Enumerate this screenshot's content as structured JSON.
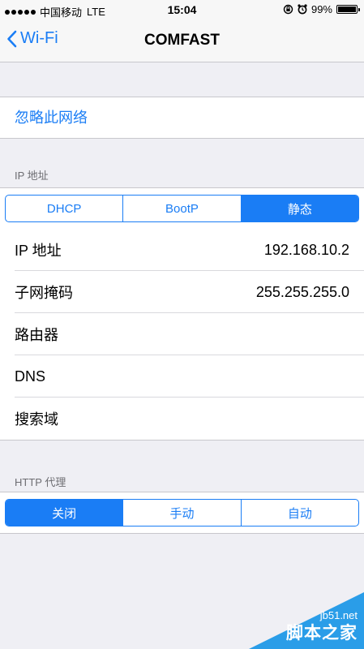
{
  "status_bar": {
    "carrier": "中国移动",
    "network": "LTE",
    "time": "15:04",
    "battery_text": "99%",
    "battery_level": 0.99
  },
  "nav": {
    "back_label": "Wi-Fi",
    "title": "COMFAST"
  },
  "forget_label": "忽略此网络",
  "ip_section": {
    "header": "IP 地址",
    "modes": [
      "DHCP",
      "BootP",
      "静态"
    ],
    "selected_mode": 2,
    "rows": [
      {
        "label": "IP 地址",
        "value": "192.168.10.2"
      },
      {
        "label": "子网掩码",
        "value": "255.255.255.0"
      },
      {
        "label": "路由器",
        "value": ""
      },
      {
        "label": "DNS",
        "value": ""
      },
      {
        "label": "搜索域",
        "value": ""
      }
    ]
  },
  "proxy_section": {
    "header": "HTTP 代理",
    "modes": [
      "关闭",
      "手动",
      "自动"
    ],
    "selected_mode": 0
  },
  "watermark": {
    "site": "jb51.net",
    "name": "脚本之家"
  },
  "colors": {
    "accent": "#1a7df5",
    "background": "#efeff4",
    "watermark": "#2a9de8"
  }
}
